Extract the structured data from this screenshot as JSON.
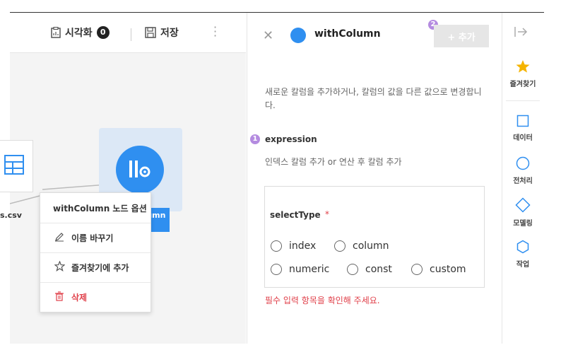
{
  "toolbar": {
    "visualize_label": "시각화",
    "visualize_count": "0",
    "save_label": "저장"
  },
  "canvas": {
    "csv_node_label": "s.csv",
    "withcolumn_node_label": "olumn"
  },
  "context_menu": {
    "title": "withColumn 노드 옵션",
    "items": [
      {
        "label": "이름 바꾸기",
        "icon": "pencil-icon"
      },
      {
        "label": "즐겨찾기에 추가",
        "icon": "star-outline-icon"
      },
      {
        "label": "삭제",
        "icon": "trash-icon"
      }
    ]
  },
  "panel": {
    "title": "withColumn",
    "add_button": "+ 추가",
    "description": "새로운 칼럼을 추가하거나, 칼럼의 값을 다른 값으로 변경합니다.",
    "expression_num": "1",
    "expression_label": "expression",
    "expression_help": "인덱스 칼럼 추가 or 연산 후 칼럼 추가",
    "add_num": "2",
    "select_type_label": "selectType",
    "required_mark": "*",
    "options": [
      "index",
      "column",
      "numeric",
      "const",
      "custom"
    ],
    "error": "필수 입력 항목을 확인해 주세요."
  },
  "sidebar": {
    "items": [
      {
        "label": "즐겨찾기",
        "icon": "star-icon"
      },
      {
        "label": "데이터",
        "icon": "square-icon"
      },
      {
        "label": "전처리",
        "icon": "circle-icon"
      },
      {
        "label": "모델링",
        "icon": "diamond-icon"
      },
      {
        "label": "작업",
        "icon": "hexagon-icon"
      }
    ]
  },
  "colors": {
    "accent": "#2f8ff0",
    "error": "#e0404a",
    "step_badge": "#b48be0"
  }
}
